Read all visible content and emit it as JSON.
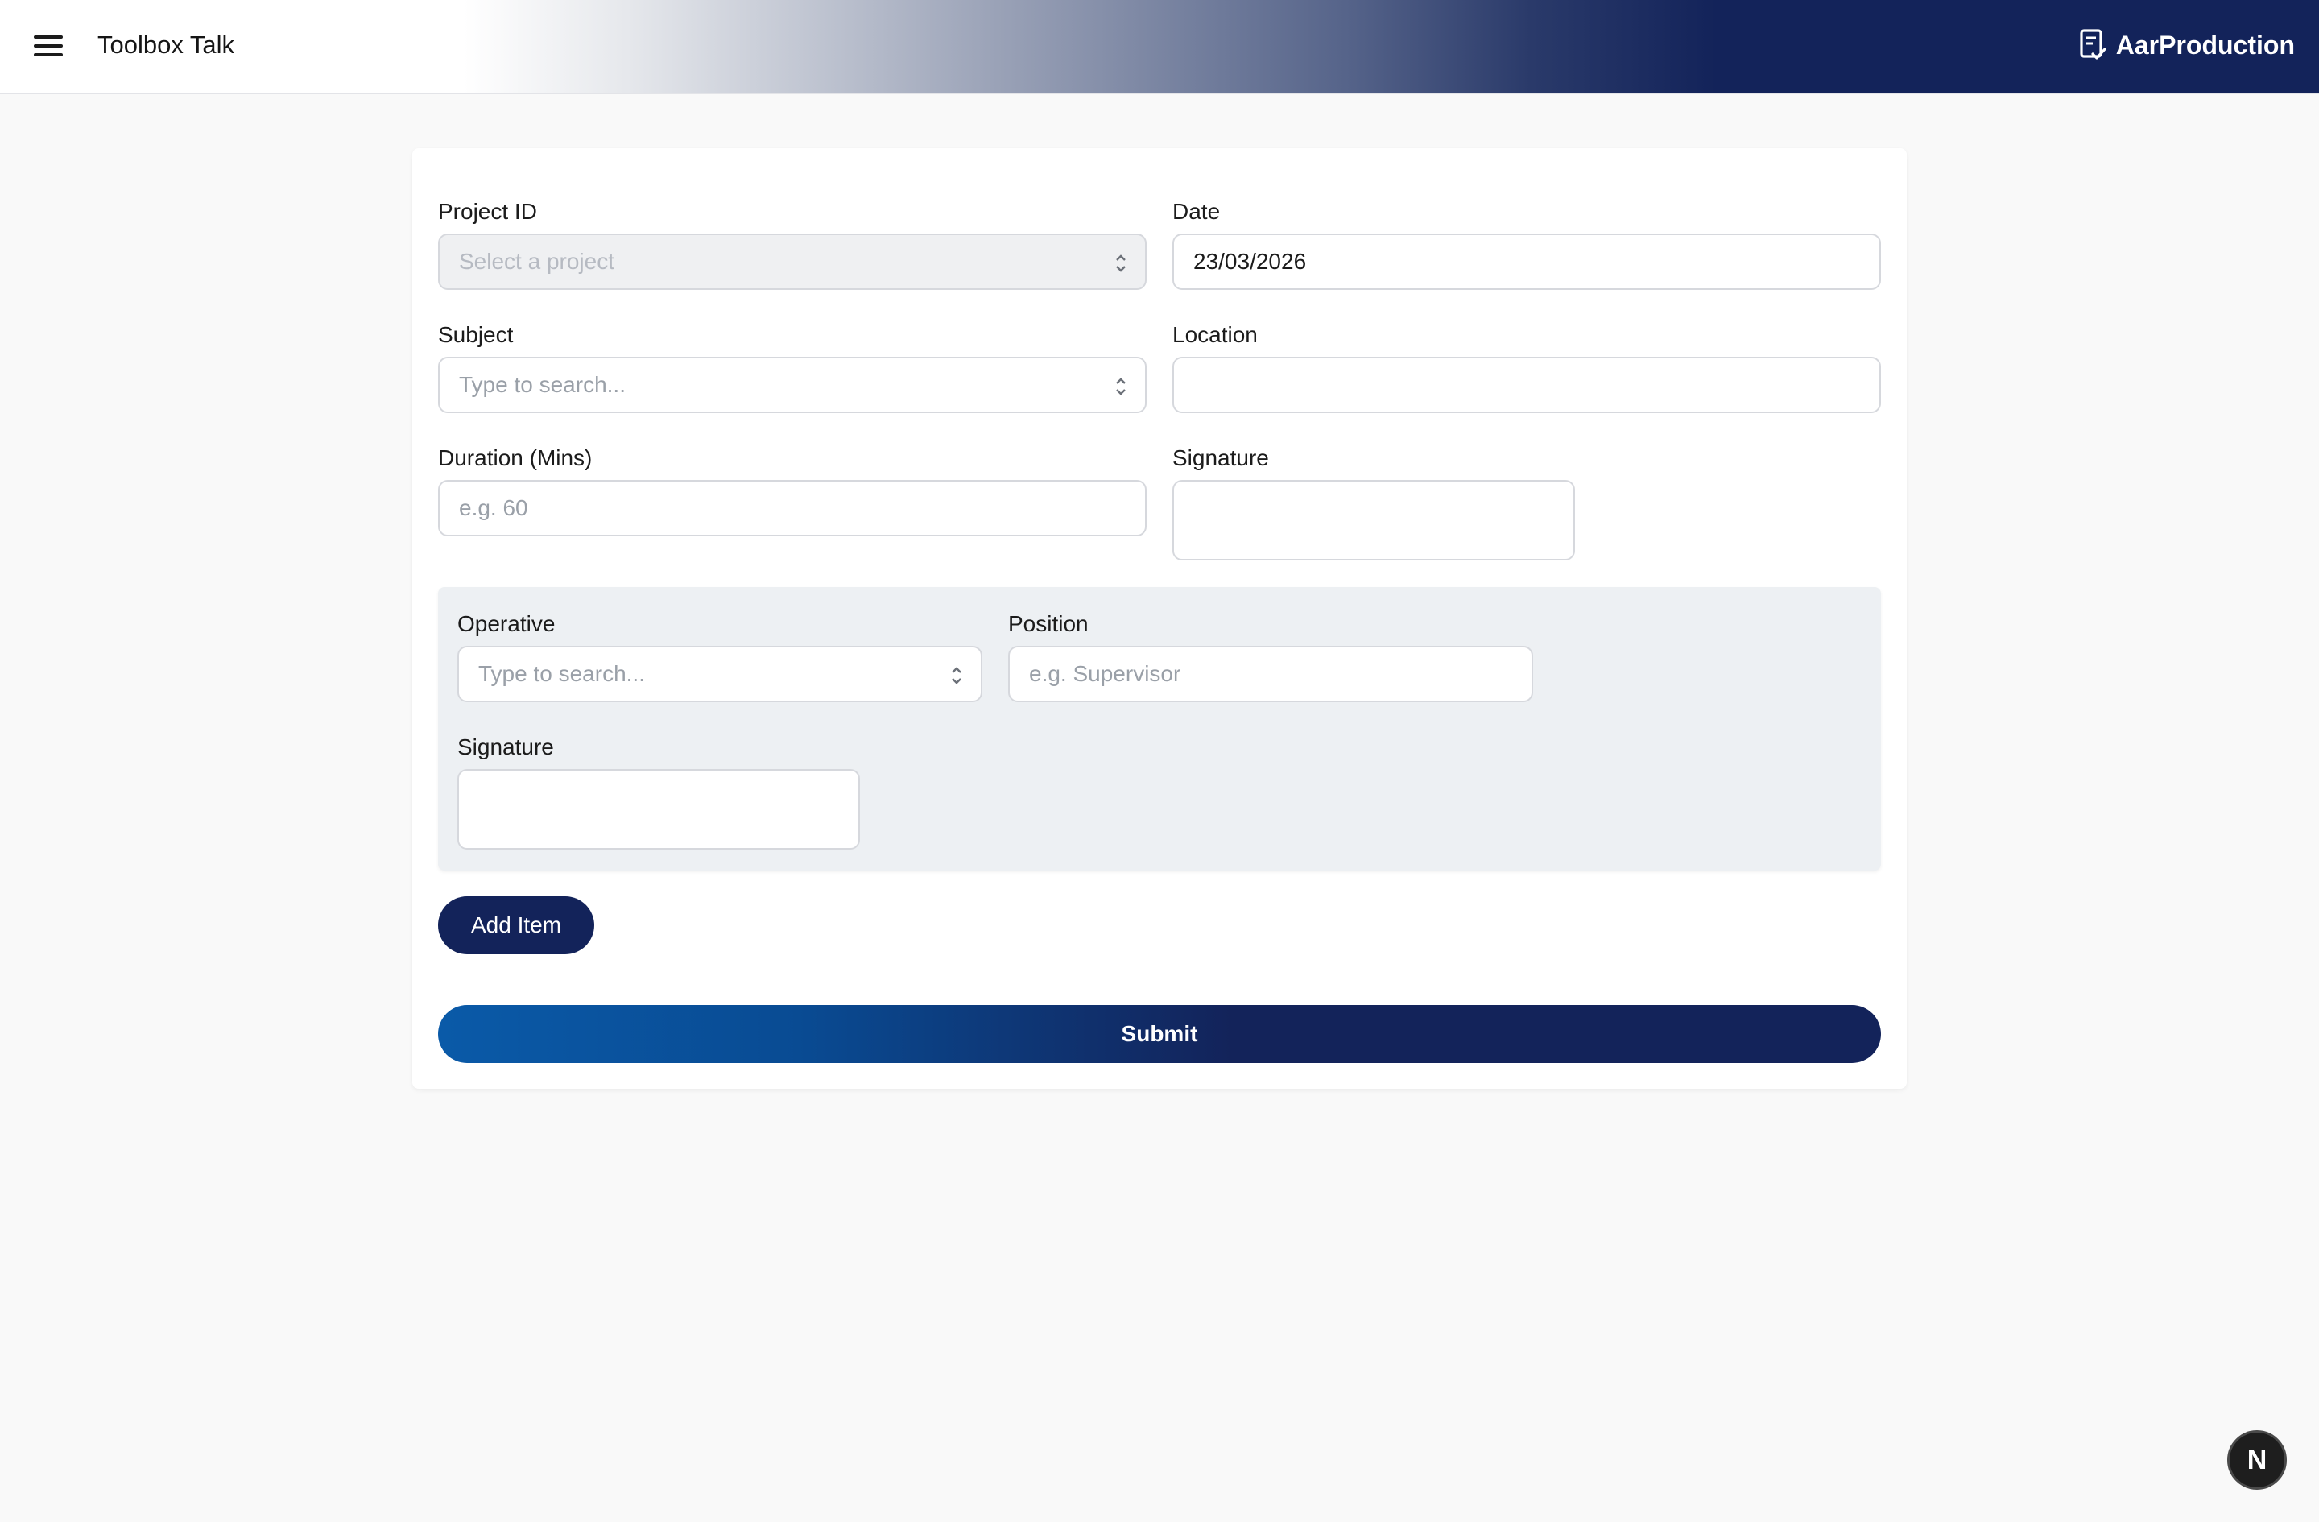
{
  "header": {
    "title": "Toolbox Talk",
    "brand": "AarProduction",
    "menu_icon": "menu-icon",
    "brand_icon": "clipboard-check-icon"
  },
  "form": {
    "project_id": {
      "label": "Project ID",
      "placeholder": "Select a project"
    },
    "date": {
      "label": "Date",
      "value": "23/03/2026"
    },
    "subject": {
      "label": "Subject",
      "placeholder": "Type to search..."
    },
    "location": {
      "label": "Location",
      "value": ""
    },
    "duration": {
      "label": "Duration (Mins)",
      "placeholder": "e.g. 60"
    },
    "signature": {
      "label": "Signature"
    }
  },
  "operative_item": {
    "operative": {
      "label": "Operative",
      "placeholder": "Type to search..."
    },
    "position": {
      "label": "Position",
      "placeholder": "e.g. Supervisor"
    },
    "signature": {
      "label": "Signature"
    }
  },
  "actions": {
    "add_item": "Add Item",
    "submit": "Submit"
  },
  "fab": {
    "label": "N"
  },
  "colors": {
    "primary": "#13235a",
    "submit_start": "#0a5aa8",
    "panel_bg": "#edf0f3",
    "page_bg": "#f9f9f9"
  }
}
